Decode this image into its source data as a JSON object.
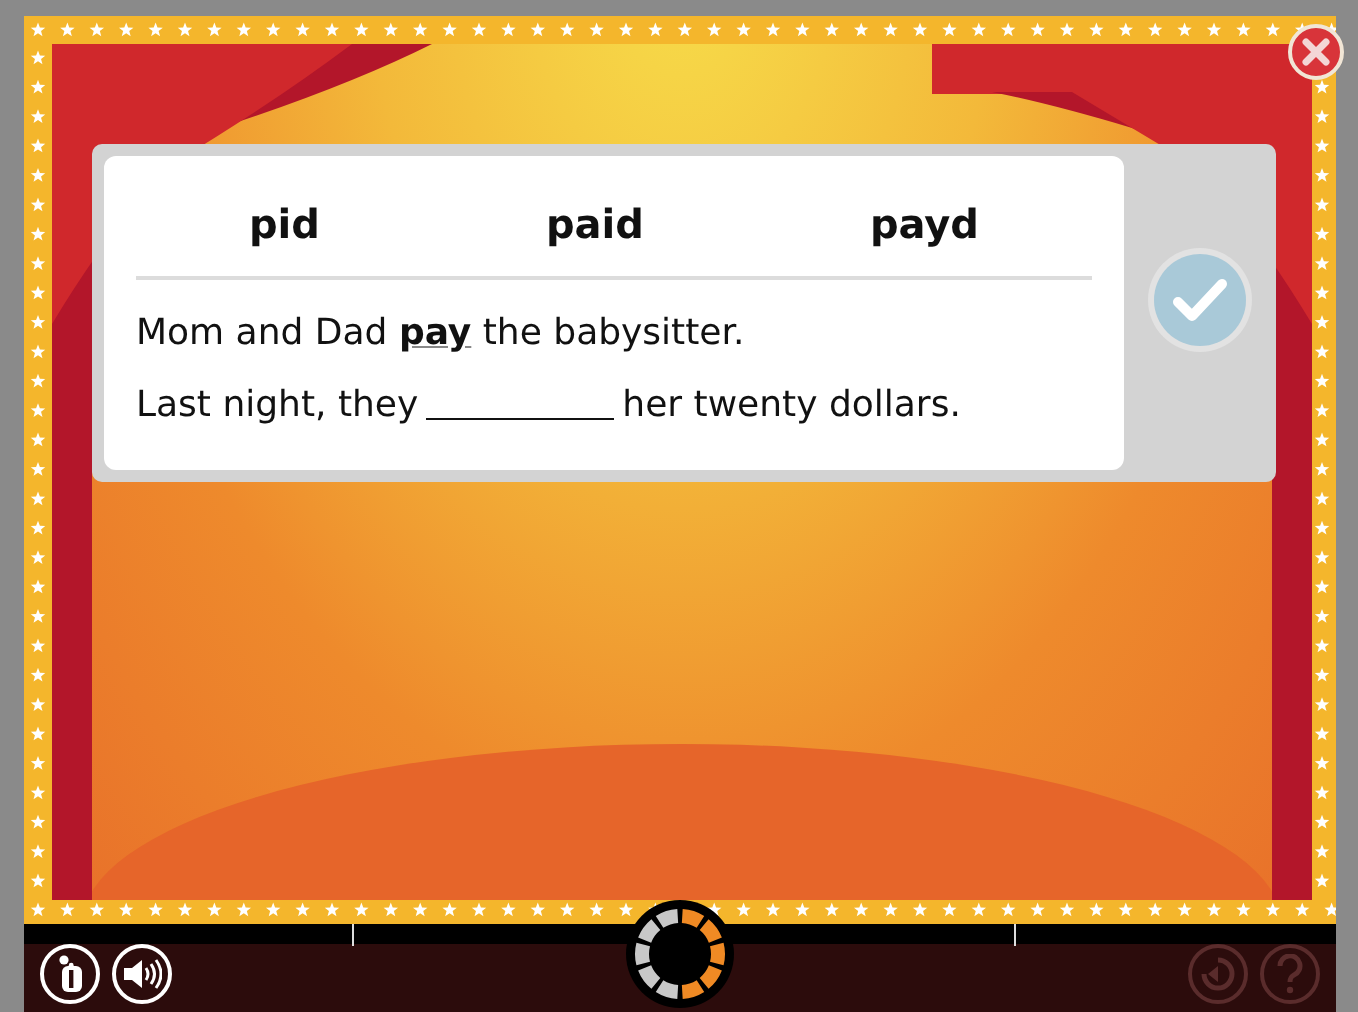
{
  "choices": [
    {
      "label": "pid",
      "selected": false
    },
    {
      "label": "paid",
      "selected": false
    },
    {
      "label": "payd",
      "selected": false
    }
  ],
  "sentences": [
    {
      "kind": "prompt",
      "text": "Mom and Dad **pay** the babysitter."
    },
    {
      "kind": "cloze",
      "before": "Last night, they",
      "after": "her twenty dollars."
    }
  ],
  "check_button": {
    "disabled": true
  },
  "progress": {
    "level": 0.5
  },
  "toolbar": [
    {
      "kind": "info",
      "disabled": false
    },
    {
      "kind": "audio",
      "disabled": false
    },
    {
      "kind": "replay",
      "disabled": true
    },
    {
      "kind": "help",
      "disabled": true
    }
  ]
}
